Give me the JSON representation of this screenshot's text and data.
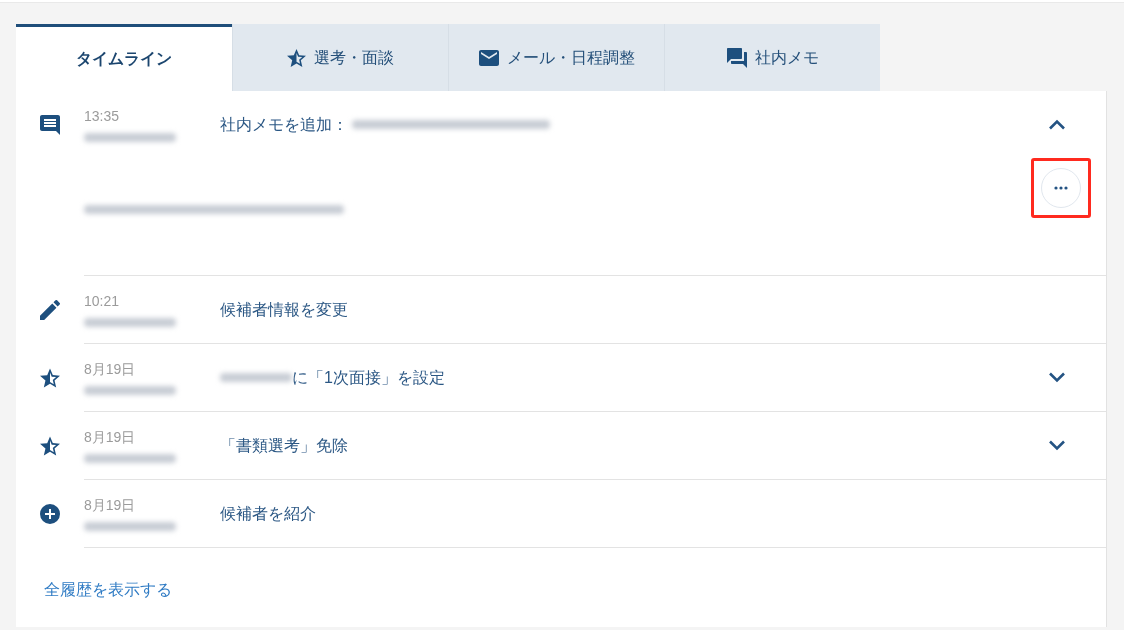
{
  "tabs": [
    {
      "label": "タイムライン",
      "kind": "timeline",
      "selected": true
    },
    {
      "label": "選考・面談",
      "kind": "selection",
      "selected": false
    },
    {
      "label": "メール・日程調整",
      "kind": "mail",
      "selected": false
    },
    {
      "label": "社内メモ",
      "kind": "memo",
      "selected": false
    }
  ],
  "entries": [
    {
      "kind": "memo",
      "time": "13:35",
      "author_redacted": true,
      "action": [
        {
          "kind": "text",
          "text": "社内メモを追加："
        },
        {
          "kind": "redacted"
        }
      ],
      "has_toggle": true,
      "expanded": true,
      "body": [
        {
          "kind": "redacted"
        }
      ],
      "more_button": {
        "highlighted": true
      }
    },
    {
      "kind": "edit",
      "time": "10:21",
      "author_redacted": true,
      "action": [
        {
          "kind": "text",
          "text": "候補者情報を変更"
        }
      ],
      "has_toggle": false,
      "expanded": false
    },
    {
      "kind": "selection",
      "time": "8月19日",
      "author_redacted": true,
      "action": [
        {
          "kind": "redacted"
        },
        {
          "kind": "text",
          "text": "に「1次面接」を設定"
        }
      ],
      "has_toggle": true,
      "expanded": false
    },
    {
      "kind": "selection",
      "time": "8月19日",
      "author_redacted": true,
      "action": [
        {
          "kind": "text",
          "text": "「書類選考」免除"
        }
      ],
      "has_toggle": true,
      "expanded": false
    },
    {
      "kind": "introduce",
      "time": "8月19日",
      "author_redacted": true,
      "action": [
        {
          "kind": "text",
          "text": "候補者を紹介"
        }
      ],
      "has_toggle": false,
      "expanded": false
    }
  ],
  "footer_link": "全履歴を表示する"
}
